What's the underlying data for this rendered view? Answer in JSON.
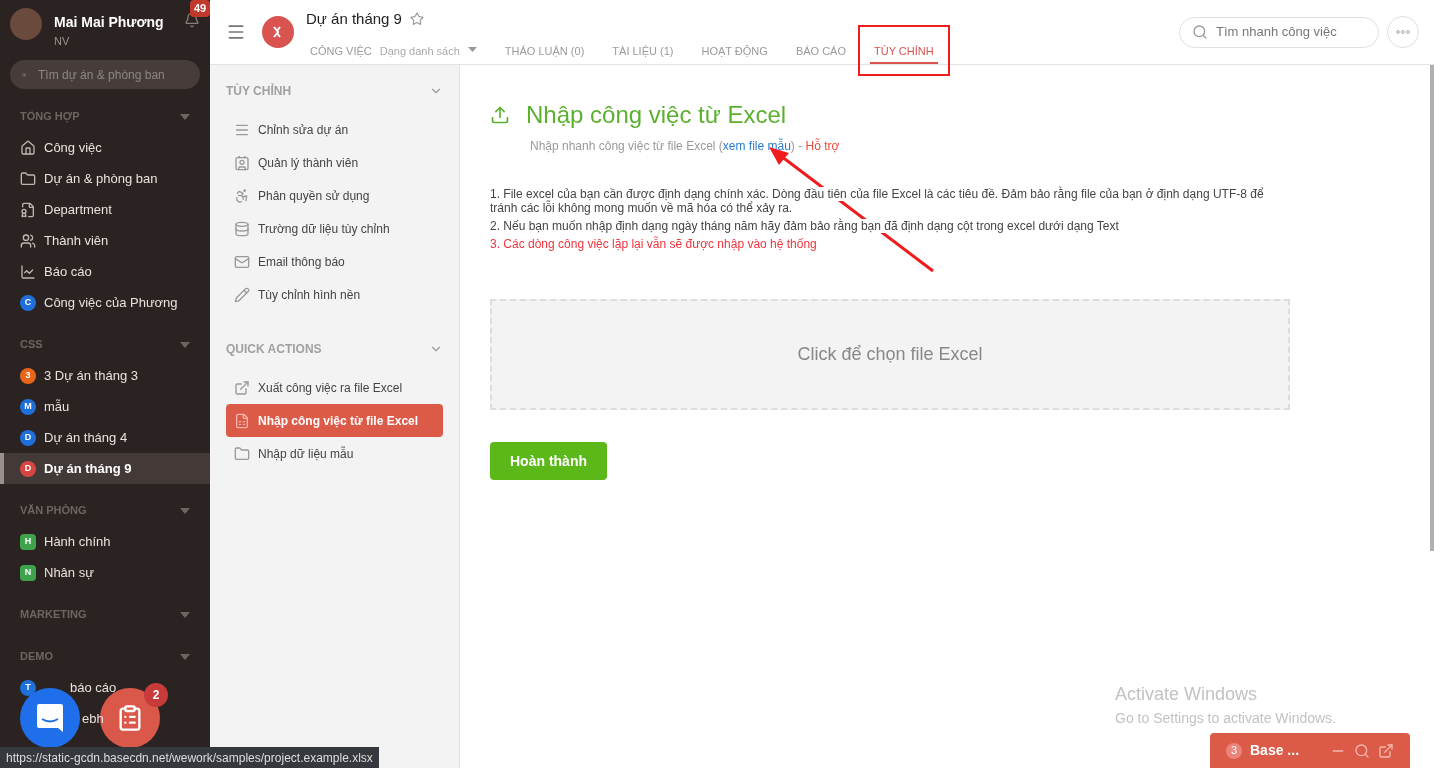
{
  "user": {
    "name": "Mai Mai Phương",
    "role": "NV",
    "notifications": "49"
  },
  "sidebar": {
    "search": {
      "placeholder": "Tìm dự án & phòng ban"
    },
    "sections": [
      {
        "title": "TỔNG HỢP",
        "items": [
          {
            "kind": "icon",
            "label": "Công việc",
            "selected": false
          },
          {
            "kind": "icon",
            "label": "Dự án & phòng ban",
            "selected": false
          },
          {
            "kind": "icon",
            "label": "Department",
            "selected": false
          },
          {
            "kind": "icon",
            "label": "Thành viên",
            "selected": false
          },
          {
            "kind": "icon",
            "label": "Báo cáo",
            "selected": false
          },
          {
            "kind": "avatar",
            "letter": "C",
            "color": "#1e6fd9",
            "label": "Công việc của Phương",
            "selected": false
          }
        ]
      },
      {
        "title": "CSS",
        "items": [
          {
            "kind": "avatar",
            "letter": "3",
            "color": "#e8641b",
            "label": "3 Dự án tháng 3",
            "selected": false
          },
          {
            "kind": "avatar",
            "letter": "M",
            "color": "#1e6fd9",
            "label": "mẫu",
            "selected": false
          },
          {
            "kind": "avatar",
            "letter": "D",
            "color": "#1e6fd9",
            "label": "Dự án tháng 4",
            "selected": false
          },
          {
            "kind": "avatar",
            "letter": "D",
            "color": "#d64541",
            "label": "Dự án tháng 9",
            "selected": true
          }
        ]
      },
      {
        "title": "VĂN PHÒNG",
        "items": [
          {
            "kind": "square",
            "letter": "H",
            "color": "#3fa34d",
            "label": "Hành chính",
            "selected": false
          },
          {
            "kind": "square",
            "letter": "N",
            "color": "#3fa34d",
            "label": "Nhân sự",
            "selected": false
          }
        ]
      },
      {
        "title": "MARKETING"
      },
      {
        "title": "DEMO",
        "items": [
          {
            "kind": "avatar",
            "letter": "T",
            "color": "#1e6fd9",
            "label": "báo cáo",
            "selected": false
          },
          {
            "kind": "covered",
            "label": "ebh",
            "selected": false
          }
        ]
      }
    ]
  },
  "header": {
    "project": "Dự án tháng 9",
    "tabs": [
      {
        "label": "CÔNG VIỆC",
        "sub": "Dạng danh sách",
        "selected": false
      },
      {
        "label": "THẢO LUẬN (0)",
        "selected": false
      },
      {
        "label": "TÀI LIỆU (1)",
        "selected": false
      },
      {
        "label": "HOẠT ĐỘNG",
        "selected": false
      },
      {
        "label": "BÁO CÁO",
        "selected": false
      },
      {
        "label": "TÙY CHỈNH",
        "selected": true
      }
    ],
    "search": {
      "placeholder": "Tìm nhanh công việc"
    }
  },
  "settings": {
    "sections": [
      {
        "title": "TÙY CHỈNH",
        "items": [
          {
            "label": "Chỉnh sửa dự án",
            "selected": false
          },
          {
            "label": "Quản lý thành viên",
            "selected": false
          },
          {
            "label": "Phân quyền sử dụng",
            "selected": false
          },
          {
            "label": "Trường dữ liệu tùy chỉnh",
            "selected": false
          },
          {
            "label": "Email thông báo",
            "selected": false
          },
          {
            "label": "Tùy chỉnh hình nền",
            "selected": false
          }
        ]
      },
      {
        "title": "QUICK ACTIONS",
        "items": [
          {
            "label": "Xuất công việc ra file Excel",
            "selected": false
          },
          {
            "label": "Nhập công việc từ file Excel",
            "selected": true
          },
          {
            "label": "Nhập dữ liệu mẫu",
            "selected": false
          }
        ]
      }
    ]
  },
  "content": {
    "title": "Nhập công việc từ Excel",
    "subtitle": "Nhập nhanh công việc từ file Excel (",
    "link": "xem file mẫu",
    "subtitle_end": ") -",
    "support": "Hỗ trợ",
    "notes": [
      {
        "kind": "normal",
        "text": "1. File excel của bạn cần được định dạng chính xác. Dòng đầu tiên của file Excel là các tiêu đề. Đảm bảo rằng file của bạn ở định dạng UTF-8 để tránh các lỗi không mong muốn về mã hóa có thể xảy ra."
      },
      {
        "kind": "normal",
        "text": "2. Nếu bạn muốn nhập định dạng ngày tháng năm hãy đảm bảo rằng bạn đã định dạng cột trong excel dưới dạng Text"
      },
      {
        "kind": "warning",
        "text": "3. Các dòng công việc lặp lại vẫn sẽ được nhập vào hệ thống"
      }
    ],
    "dropzone": "Click để chọn file Excel",
    "submit": "Hoàn thành"
  },
  "fab": {
    "badge": "2"
  },
  "chat": {
    "count": "3",
    "title": "Base ..."
  },
  "watermark": {
    "title": "Activate Windows",
    "text": "Go to Settings to activate Windows."
  },
  "status_bar": {
    "url": "https://static-gcdn.basecdn.net/wework/samples/project.example.xlsx"
  }
}
